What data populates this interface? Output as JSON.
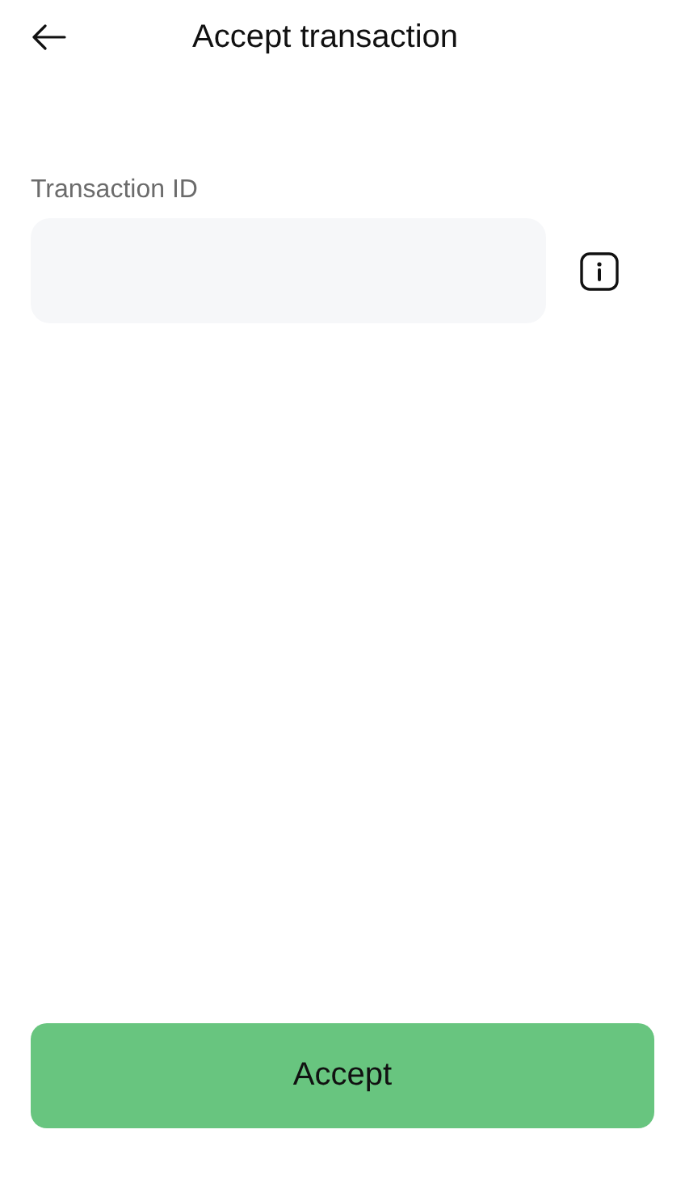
{
  "header": {
    "title": "Accept transaction"
  },
  "field": {
    "label": "Transaction ID"
  },
  "button": {
    "label": "Accept"
  }
}
